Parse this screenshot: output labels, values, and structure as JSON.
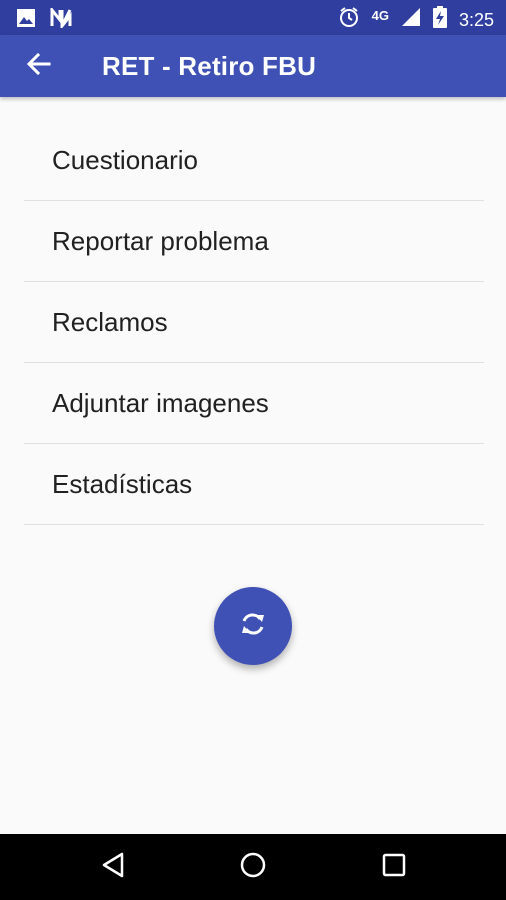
{
  "status_bar": {
    "network": "4G",
    "time": "3:25",
    "icons": [
      "image-icon",
      "n-icon",
      "alarm-icon",
      "signal-icon",
      "battery-charging-icon"
    ]
  },
  "app_bar": {
    "title": "RET - Retiro FBU",
    "back_icon": "arrow-back-icon"
  },
  "menu": {
    "items": [
      {
        "label": "Cuestionario"
      },
      {
        "label": "Reportar problema"
      },
      {
        "label": "Reclamos"
      },
      {
        "label": "Adjuntar imagenes"
      },
      {
        "label": "Estadísticas"
      }
    ]
  },
  "fab": {
    "icon": "sync-icon"
  },
  "nav_bar": {
    "icons": [
      "back-triangle-icon",
      "home-circle-icon",
      "recents-square-icon"
    ]
  },
  "colors": {
    "status_bar": "#303f9f",
    "app_bar": "#3f51b5",
    "fab": "#3f51b5",
    "background": "#fafafa",
    "divider": "#e0e0e0",
    "text": "#212121"
  }
}
